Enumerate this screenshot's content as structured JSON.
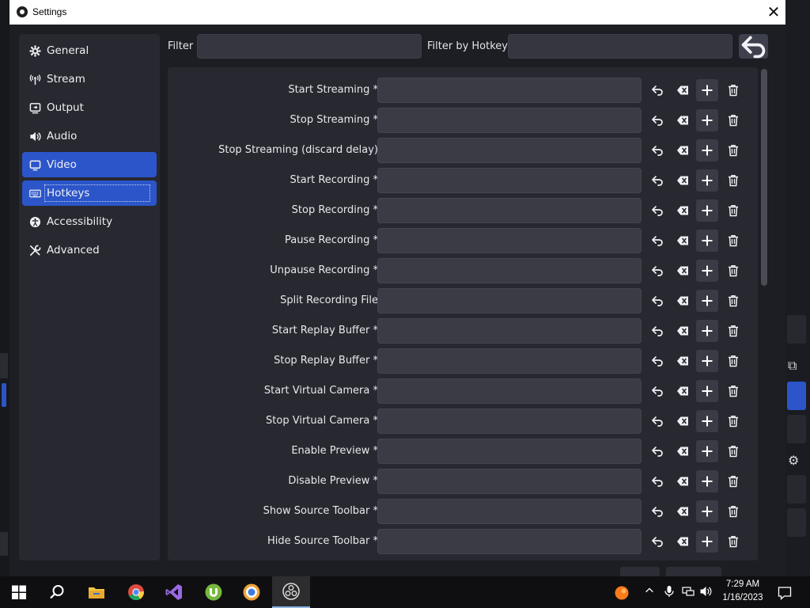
{
  "window": {
    "title": "Settings"
  },
  "sidebar": {
    "items": [
      {
        "label": "General",
        "icon": "gear-icon"
      },
      {
        "label": "Stream",
        "icon": "broadcast-icon"
      },
      {
        "label": "Output",
        "icon": "output-icon"
      },
      {
        "label": "Audio",
        "icon": "speaker-icon"
      },
      {
        "label": "Video",
        "icon": "monitor-icon",
        "active": true
      },
      {
        "label": "Hotkeys",
        "icon": "keyboard-icon",
        "active": true,
        "focused": true
      },
      {
        "label": "Accessibility",
        "icon": "accessibility-icon"
      },
      {
        "label": "Advanced",
        "icon": "tools-icon"
      }
    ]
  },
  "filter": {
    "label": "Filter",
    "value": "",
    "hotkey_label": "Filter by Hotkey",
    "hotkey_value": ""
  },
  "hotkeys": [
    {
      "label": "Start Streaming *",
      "value": ""
    },
    {
      "label": "Stop Streaming *",
      "value": ""
    },
    {
      "label": "Stop Streaming (discard delay)",
      "value": ""
    },
    {
      "label": "Start Recording *",
      "value": ""
    },
    {
      "label": "Stop Recording *",
      "value": ""
    },
    {
      "label": "Pause Recording *",
      "value": ""
    },
    {
      "label": "Unpause Recording *",
      "value": ""
    },
    {
      "label": "Split Recording File",
      "value": ""
    },
    {
      "label": "Start Replay Buffer *",
      "value": ""
    },
    {
      "label": "Stop Replay Buffer *",
      "value": ""
    },
    {
      "label": "Start Virtual Camera *",
      "value": ""
    },
    {
      "label": "Stop Virtual Camera *",
      "value": ""
    },
    {
      "label": "Enable Preview *",
      "value": ""
    },
    {
      "label": "Disable Preview *",
      "value": ""
    },
    {
      "label": "Show Source Toolbar *",
      "value": ""
    },
    {
      "label": "Hide Source Toolbar *",
      "value": ""
    }
  ],
  "hotkey_row_icons": [
    "undo-icon",
    "clear-icon",
    "plus-icon",
    "trash-icon"
  ],
  "taskbar": {
    "apps": [
      "windows-start-icon",
      "search-icon",
      "file-explorer-icon",
      "chrome-icon",
      "visual-studio-icon",
      "utorrent-icon",
      "browser-icon",
      "obs-icon"
    ],
    "time": "7:29 AM",
    "date": "1/16/2023"
  },
  "colors": {
    "accent": "#2b55c9",
    "panel": "#272830",
    "input": "#3a3b44"
  }
}
